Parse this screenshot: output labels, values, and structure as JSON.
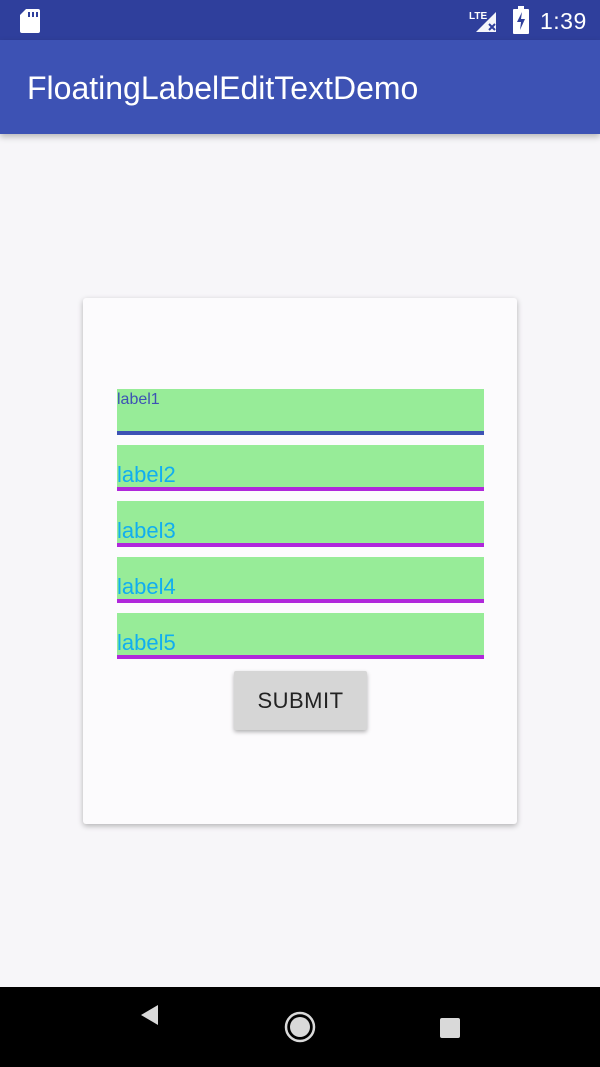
{
  "status_bar": {
    "time": "1:39",
    "network_label": "LTE",
    "icons": [
      "sd-card-icon",
      "lte-signal-icon",
      "battery-charging-icon"
    ]
  },
  "app_bar": {
    "title": "FloatingLabelEditTextDemo"
  },
  "form": {
    "fields": [
      {
        "label": "label1",
        "state": "focused"
      },
      {
        "label": "label2",
        "state": "idle"
      },
      {
        "label": "label3",
        "state": "idle"
      },
      {
        "label": "label4",
        "state": "idle"
      },
      {
        "label": "label5",
        "state": "idle"
      }
    ],
    "submit_label": "SUBMIT"
  },
  "nav_bar": {
    "icons": [
      "back-icon",
      "home-icon",
      "recents-icon"
    ]
  },
  "colors": {
    "status_bar": "#2f3f9c",
    "app_bar": "#3d52b4",
    "field_background": "#97ec98",
    "field_underline": "#b027db",
    "focused_underline": "#3d52b4",
    "label_text": "#11aef0"
  }
}
